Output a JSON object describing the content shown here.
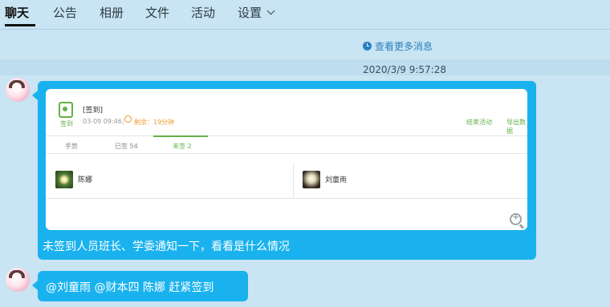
{
  "tabs": [
    {
      "label": "聊天"
    },
    {
      "label": "公告"
    },
    {
      "label": "相册"
    },
    {
      "label": "文件"
    },
    {
      "label": "活动"
    },
    {
      "label": "设置"
    }
  ],
  "history_link": "查看更多消息",
  "timestamp": "2020/3/9 9:57:28",
  "screenshot": {
    "icon_caption": "签到",
    "title": "[签到]",
    "date": "03-09 09:46",
    "remaining": "剩余：19分钟",
    "action_end": "结束活动",
    "action_export": "导出数据",
    "sub_tabs": [
      "手势",
      "已签 54",
      "未签 2"
    ],
    "people": [
      "陈娜",
      "刘童雨"
    ]
  },
  "messages": [
    {
      "text": "未签到人员班长、学委通知一下，看看是什么情况"
    },
    {
      "text": "@刘童雨 @财本四 陈娜 赶紧签到"
    }
  ],
  "colors": {
    "bubble": "#1ab2ee",
    "accent_green": "#65b04a",
    "warning_orange": "#f09a2a"
  }
}
